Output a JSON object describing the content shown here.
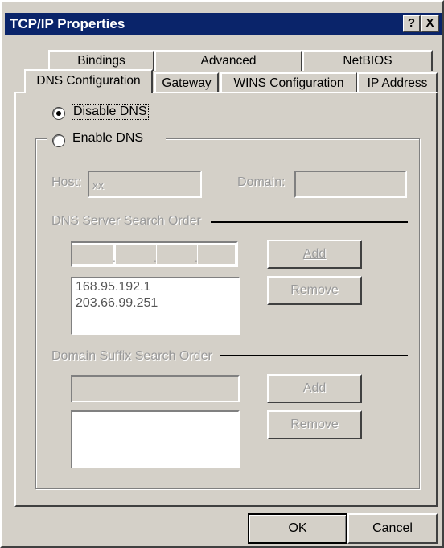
{
  "title": "TCP/IP Properties",
  "title_buttons": {
    "help": "?",
    "close": "X"
  },
  "tabs_back": [
    "Bindings",
    "Advanced",
    "NetBIOS"
  ],
  "tabs_front": [
    "DNS Configuration",
    "Gateway",
    "WINS Configuration",
    "IP Address"
  ],
  "dns": {
    "disable_label": "Disable DNS",
    "enable_label": "Enable DNS",
    "host_label": "Host:",
    "host_value": "xx",
    "domain_label": "Domain:",
    "domain_value": "",
    "server_order_label": "DNS Server Search Order",
    "server_list": [
      "168.95.192.1",
      "203.66.99.251"
    ],
    "add_label": "Add",
    "remove_label": "Remove",
    "suffix_order_label": "Domain Suffix Search Order",
    "suffix_add_label": "Add",
    "suffix_remove_label": "Remove"
  },
  "footer": {
    "ok_label": "OK",
    "cancel_label": "Cancel"
  }
}
